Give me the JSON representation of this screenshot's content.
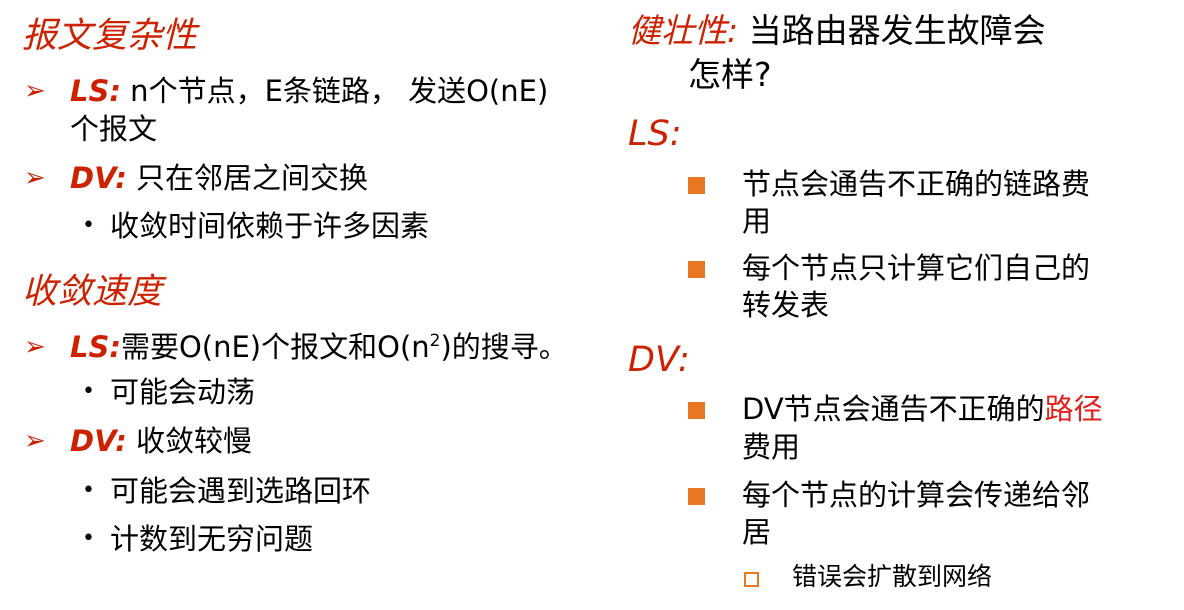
{
  "left": {
    "complexity": {
      "title": "报文复杂性",
      "items": [
        {
          "label": "LS:",
          "text": " n个节点，E条链路， 发送O(nE)",
          "cont": "个报文"
        },
        {
          "label": "DV:",
          "text": " 只在邻居之间交换"
        }
      ],
      "sub": [
        "收敛时间依赖于许多因素"
      ]
    },
    "speed": {
      "title": "收敛速度",
      "ls_label": "LS:",
      "ls_pre": "需要O(nE)个报文和O(n",
      "ls_sup": "2",
      "ls_post": ")的搜寻。",
      "ls_sub": [
        "可能会动荡"
      ],
      "dv_label": "DV:",
      "dv_text": " 收敛较慢",
      "dv_sub": [
        "可能会遇到选路回环",
        "计数到无穷问题"
      ]
    }
  },
  "right": {
    "robust_label": "健壮性:",
    "robust_text": " 当路由器发生故障会",
    "robust_cont": "怎样?",
    "ls_head": "LS:",
    "ls_items": [
      [
        "节点会通告不正确的链路费",
        "用"
      ],
      [
        "每个节点只计算它们自己的",
        "转发表"
      ]
    ],
    "dv_head": "DV:",
    "dv_item1": {
      "pre": "DV节点会通告不正确的",
      "highlight": "路径",
      "cont": "费用"
    },
    "dv_item2": [
      "每个节点的计算会传递给邻",
      "居"
    ],
    "dv_sub": "错误会扩散到网络"
  },
  "colors": {
    "accent_red": "#cc2200",
    "highlight_red": "#e0201c",
    "bullet_orange": "#e87722"
  }
}
